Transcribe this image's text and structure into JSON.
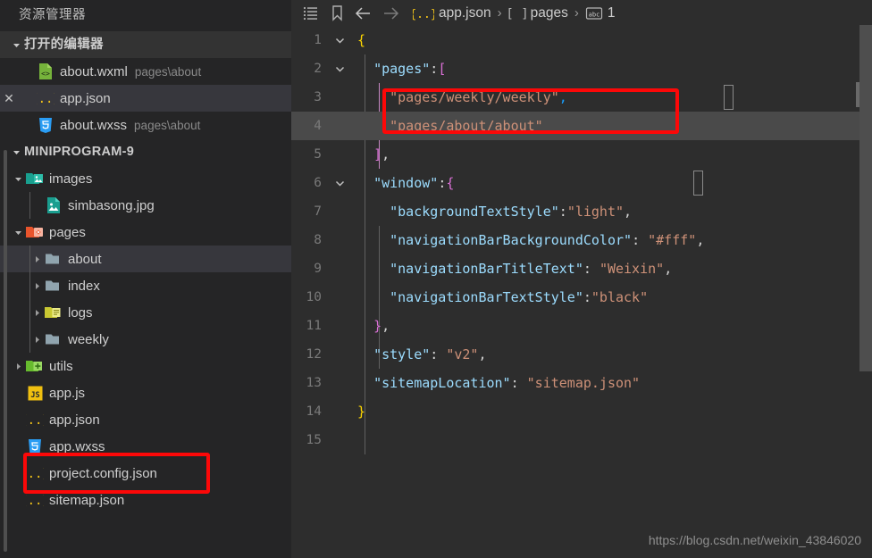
{
  "sidebar": {
    "title": "资源管理器",
    "open_editors": {
      "label": "打开的编辑器",
      "items": [
        {
          "name": "about.wxml",
          "path": "pages\\about",
          "icon": "wxml-file-icon",
          "closable": false,
          "selected": false
        },
        {
          "name": "app.json",
          "path": "",
          "icon": "json-file-icon",
          "closable": true,
          "selected": true
        },
        {
          "name": "about.wxss",
          "path": "pages\\about",
          "icon": "wxss-file-icon",
          "closable": false,
          "selected": false
        }
      ]
    },
    "project": {
      "label": "MINIPROGRAM-9",
      "tree": [
        {
          "name": "images",
          "type": "folder",
          "icon": "folder-images-icon",
          "depth": 1,
          "expanded": true,
          "arrow": "down",
          "selected": false
        },
        {
          "name": "simbasong.jpg",
          "type": "file",
          "icon": "image-file-icon",
          "depth": 2,
          "expanded": null,
          "arrow": "none",
          "selected": false
        },
        {
          "name": "pages",
          "type": "folder",
          "icon": "folder-pages-icon",
          "depth": 1,
          "expanded": true,
          "arrow": "down",
          "selected": false
        },
        {
          "name": "about",
          "type": "folder",
          "icon": "folder-plain-icon",
          "depth": 2,
          "expanded": false,
          "arrow": "right",
          "selected": true
        },
        {
          "name": "index",
          "type": "folder",
          "icon": "folder-plain-icon",
          "depth": 2,
          "expanded": false,
          "arrow": "right",
          "selected": false
        },
        {
          "name": "logs",
          "type": "folder",
          "icon": "folder-logs-icon",
          "depth": 2,
          "expanded": false,
          "arrow": "right",
          "selected": false
        },
        {
          "name": "weekly",
          "type": "folder",
          "icon": "folder-plain-icon",
          "depth": 2,
          "expanded": false,
          "arrow": "right",
          "selected": false
        },
        {
          "name": "utils",
          "type": "folder",
          "icon": "folder-utils-icon",
          "depth": 1,
          "expanded": false,
          "arrow": "right",
          "selected": false
        },
        {
          "name": "app.js",
          "type": "file",
          "icon": "js-file-icon",
          "depth": 1,
          "expanded": null,
          "arrow": "none",
          "selected": false
        },
        {
          "name": "app.json",
          "type": "file",
          "icon": "json-file-icon",
          "depth": 1,
          "expanded": null,
          "arrow": "none",
          "selected": false
        },
        {
          "name": "app.wxss",
          "type": "file",
          "icon": "wxss-file-icon",
          "depth": 1,
          "expanded": null,
          "arrow": "none",
          "selected": false
        },
        {
          "name": "project.config.json",
          "type": "file",
          "icon": "json-file-icon",
          "depth": 1,
          "expanded": null,
          "arrow": "none",
          "selected": false
        },
        {
          "name": "sitemap.json",
          "type": "file",
          "icon": "json-file-icon",
          "depth": 1,
          "expanded": null,
          "arrow": "none",
          "selected": false
        }
      ]
    }
  },
  "breadcrumb": {
    "icons": [
      "outline-list-icon",
      "bookmark-icon",
      "arrow-left-icon",
      "arrow-right-icon"
    ],
    "segments": [
      {
        "label": "app.json",
        "symbol": "json-braces-icon"
      },
      {
        "label": "pages",
        "symbol": "array-brackets-icon"
      },
      {
        "label": "1",
        "symbol": "string-abc-icon"
      }
    ],
    "separator": "›"
  },
  "editor": {
    "file": "app.json",
    "lines": [
      {
        "num": "1",
        "fold": "down",
        "tokens": [
          {
            "t": "{",
            "c": "tk-brace"
          }
        ]
      },
      {
        "num": "2",
        "fold": "down",
        "tokens": [
          {
            "t": "  ",
            "c": "tk-punc"
          },
          {
            "t": "\"pages\"",
            "c": "tk-key"
          },
          {
            "t": ":",
            "c": "tk-colon"
          },
          {
            "t": "[",
            "c": "tk-bracket2"
          }
        ]
      },
      {
        "num": "3",
        "fold": "",
        "tokens": [
          {
            "t": "    ",
            "c": "tk-punc"
          },
          {
            "t": "\"pages/weekly/weekly\"",
            "c": "tk-str"
          },
          {
            "t": ",",
            "c": "tk-comma"
          }
        ]
      },
      {
        "num": "4",
        "fold": "",
        "tokens": [
          {
            "t": "    ",
            "c": "tk-punc"
          },
          {
            "t": "\"pages/about/about\"",
            "c": "tk-str"
          }
        ]
      },
      {
        "num": "5",
        "fold": "",
        "tokens": [
          {
            "t": "  ",
            "c": "tk-punc"
          },
          {
            "t": "]",
            "c": "tk-bracket2"
          },
          {
            "t": ",",
            "c": "tk-punc"
          }
        ]
      },
      {
        "num": "6",
        "fold": "down",
        "tokens": [
          {
            "t": "  ",
            "c": "tk-punc"
          },
          {
            "t": "\"window\"",
            "c": "tk-key"
          },
          {
            "t": ":",
            "c": "tk-colon"
          },
          {
            "t": "{",
            "c": "tk-bracket2"
          }
        ]
      },
      {
        "num": "7",
        "fold": "",
        "tokens": [
          {
            "t": "    ",
            "c": "tk-punc"
          },
          {
            "t": "\"backgroundTextStyle\"",
            "c": "tk-key"
          },
          {
            "t": ":",
            "c": "tk-colon"
          },
          {
            "t": "\"light\"",
            "c": "tk-str"
          },
          {
            "t": ",",
            "c": "tk-punc"
          }
        ]
      },
      {
        "num": "8",
        "fold": "",
        "tokens": [
          {
            "t": "    ",
            "c": "tk-punc"
          },
          {
            "t": "\"navigationBarBackgroundColor\"",
            "c": "tk-key"
          },
          {
            "t": ": ",
            "c": "tk-colon"
          },
          {
            "t": "\"#fff\"",
            "c": "tk-str"
          },
          {
            "t": ",",
            "c": "tk-punc"
          }
        ]
      },
      {
        "num": "9",
        "fold": "",
        "tokens": [
          {
            "t": "    ",
            "c": "tk-punc"
          },
          {
            "t": "\"navigationBarTitleText\"",
            "c": "tk-key"
          },
          {
            "t": ": ",
            "c": "tk-colon"
          },
          {
            "t": "\"Weixin\"",
            "c": "tk-str"
          },
          {
            "t": ",",
            "c": "tk-punc"
          }
        ]
      },
      {
        "num": "10",
        "fold": "",
        "tokens": [
          {
            "t": "    ",
            "c": "tk-punc"
          },
          {
            "t": "\"navigationBarTextStyle\"",
            "c": "tk-key"
          },
          {
            "t": ":",
            "c": "tk-colon"
          },
          {
            "t": "\"black\"",
            "c": "tk-str"
          }
        ]
      },
      {
        "num": "11",
        "fold": "",
        "tokens": [
          {
            "t": "  ",
            "c": "tk-punc"
          },
          {
            "t": "}",
            "c": "tk-bracket2"
          },
          {
            "t": ",",
            "c": "tk-punc"
          }
        ]
      },
      {
        "num": "12",
        "fold": "",
        "tokens": [
          {
            "t": "  ",
            "c": "tk-punc"
          },
          {
            "t": "\"style\"",
            "c": "tk-key"
          },
          {
            "t": ": ",
            "c": "tk-colon"
          },
          {
            "t": "\"v2\"",
            "c": "tk-str"
          },
          {
            "t": ",",
            "c": "tk-punc"
          }
        ]
      },
      {
        "num": "13",
        "fold": "",
        "tokens": [
          {
            "t": "  ",
            "c": "tk-punc"
          },
          {
            "t": "\"sitemapLocation\"",
            "c": "tk-key"
          },
          {
            "t": ": ",
            "c": "tk-colon"
          },
          {
            "t": "\"sitemap.json\"",
            "c": "tk-str"
          }
        ]
      },
      {
        "num": "14",
        "fold": "",
        "tokens": [
          {
            "t": "}",
            "c": "tk-brace"
          }
        ]
      },
      {
        "num": "15",
        "fold": "",
        "tokens": []
      }
    ],
    "selected_line": "4",
    "selected_text": "\"pages/about/about\""
  },
  "annotations": [
    {
      "name": "highlight-code-line-3",
      "target": "\"pages/weekly/weekly\","
    },
    {
      "name": "highlight-sidebar-appjson",
      "target": "app.json"
    }
  ],
  "watermark": "https://blog.csdn.net/weixin_43846020",
  "colors": {
    "annotation_red": "#fc0808",
    "sidebar_bg": "#252526",
    "editor_bg": "#2d2d2d",
    "selection_blue": "#264f78",
    "string_orange": "#ce9178",
    "key_blue": "#9cdcfe"
  }
}
